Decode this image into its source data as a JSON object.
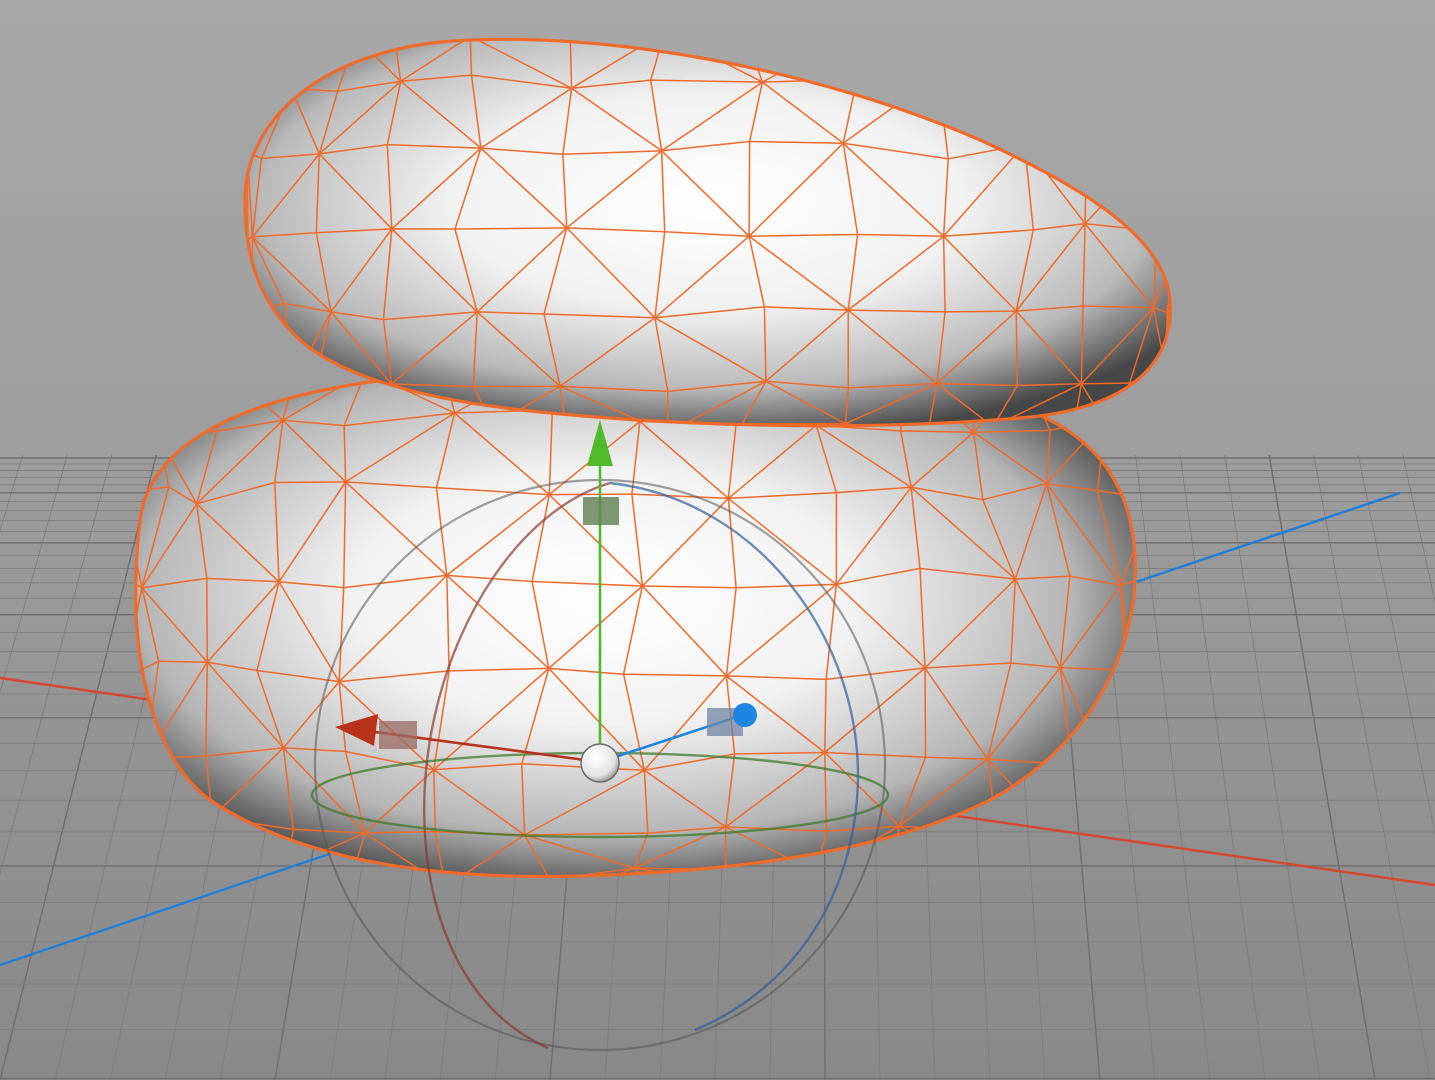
{
  "viewport": {
    "background_top": "#a6a6a6",
    "background_bottom": "#888888",
    "grid_color": "#6f6f6f"
  },
  "axes": {
    "x_color": "#d9452b",
    "y_color": "#4caf2a",
    "z_color": "#1f7fd8"
  },
  "mesh": {
    "wire_color": "#f06a2a",
    "objects": [
      "upper-blob",
      "lower-blob"
    ]
  },
  "gizmo": {
    "mode": "move-rotate",
    "x_handle_color": "#b8321c",
    "y_handle_color": "#4fbb2b",
    "z_handle_color": "#1c86e0",
    "center_color": "#ffffff",
    "ring_color": "#555555"
  }
}
